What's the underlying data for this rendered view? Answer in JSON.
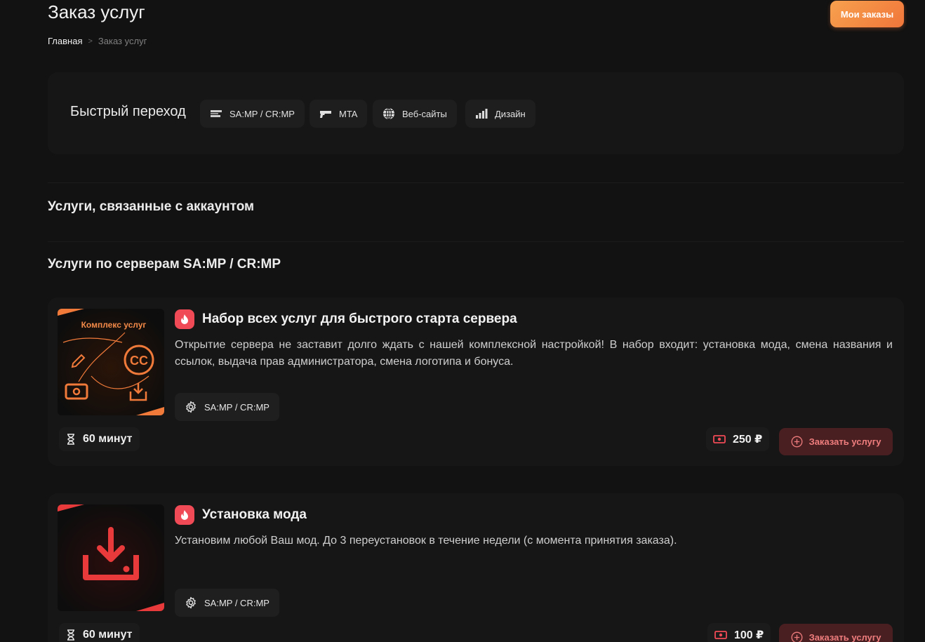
{
  "header": {
    "title": "Заказ услуг",
    "my_orders_label": "Мои заказы"
  },
  "breadcrumb": {
    "home": "Главная",
    "separator": ">",
    "current": "Заказ услуг"
  },
  "quick_nav": {
    "title": "Быстрый переход",
    "items": [
      {
        "label": "SA:MP / CR:MP",
        "icon": "samp-logo-icon"
      },
      {
        "label": "MTA",
        "icon": "gun-icon"
      },
      {
        "label": "Веб-сайты",
        "icon": "globe-icon"
      },
      {
        "label": "Дизайн",
        "icon": "chart-bars-icon"
      }
    ]
  },
  "sections": {
    "account": "Услуги, связанные с аккаунтом",
    "samp": "Услуги по серверам SA:MP / CR:MP"
  },
  "services": [
    {
      "title": "Набор всех услуг для быстрого старта сервера",
      "description": "Открытие сервера не заставит долго ждать с нашей комплексной настройкой! В набор входит: установка мода, смена названия и ссылок, выдача прав администратора, смена логотипа и бонуса.",
      "thumb_label": "Комплекс услуг",
      "thumb_icon": "services-bundle-icon",
      "accent": "#f07a3a",
      "tag": "SA:MP / CR:MP",
      "duration": "60 минут",
      "price": "250 ₽",
      "order_label": "Заказать услугу"
    },
    {
      "title": "Установка мода",
      "description": "Установим любой Ваш мод. До 3 переустановок в течение недели (с момента принятия заказа).",
      "thumb_icon": "download-tray-icon",
      "accent": "#e83a3a",
      "tag": "SA:MP / CR:MP",
      "duration": "60 минут",
      "price": "100 ₽",
      "order_label": "Заказать услугу"
    }
  ],
  "colors": {
    "background": "#121212",
    "card": "#161616",
    "orange": "#f0763a",
    "red": "#ef4a55"
  }
}
